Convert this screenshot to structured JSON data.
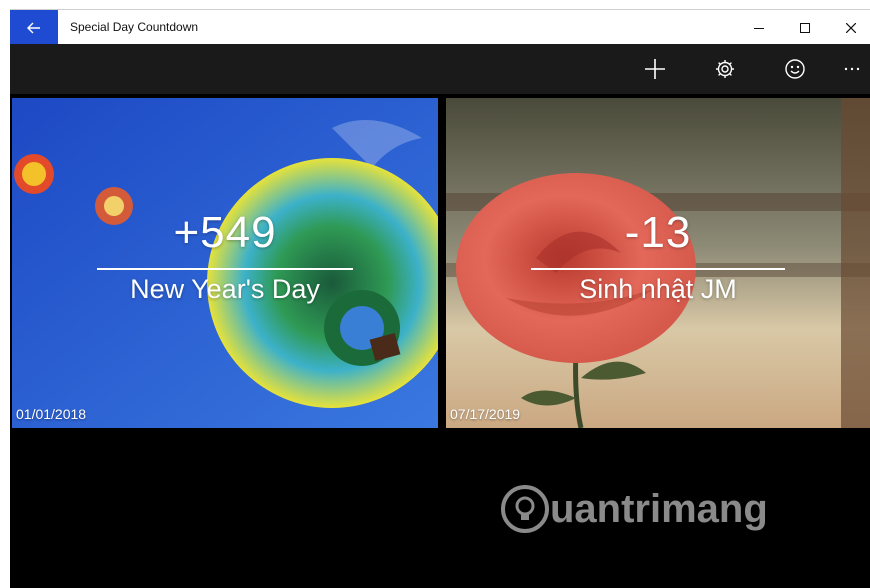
{
  "window": {
    "title": "Special Day Countdown",
    "back_icon": "arrow-left-icon",
    "controls": [
      "minimize",
      "maximize",
      "close"
    ]
  },
  "toolbar": {
    "buttons": [
      {
        "icon": "add-icon"
      },
      {
        "icon": "settings-icon"
      },
      {
        "icon": "smiley-icon"
      },
      {
        "icon": "more-icon"
      }
    ]
  },
  "events": [
    {
      "count": "+549",
      "name": "New Year's Day",
      "date": "01/01/2018",
      "theme": "hot-air-balloon"
    },
    {
      "count": "-13",
      "name": "Sinh nhật JM",
      "date": "07/17/2019",
      "theme": "rose"
    }
  ],
  "watermark": {
    "text": "uantrimang"
  },
  "colors": {
    "accent": "#1e4bd2",
    "commandbar": "#1a1a1a",
    "background": "#000000"
  }
}
